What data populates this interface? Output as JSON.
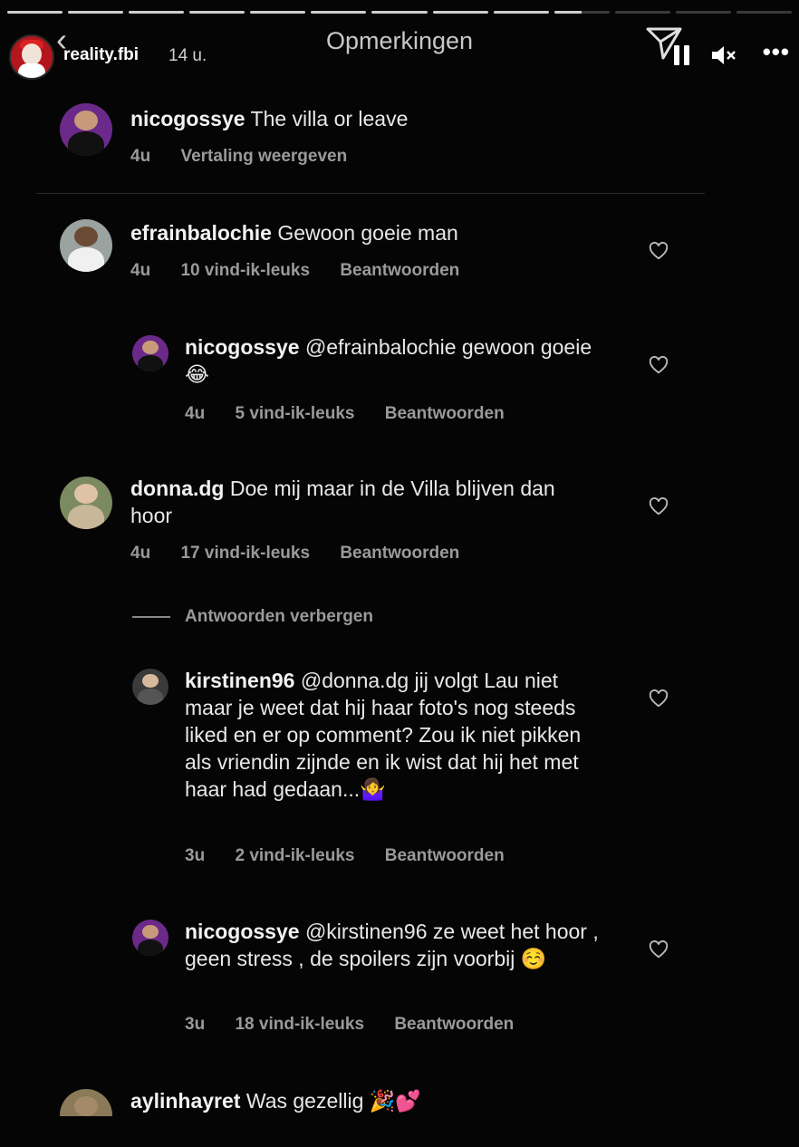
{
  "story": {
    "username": "reality.fbi",
    "time": "14 u.",
    "progress_segments": [
      1,
      1,
      1,
      1,
      1,
      1,
      1,
      1,
      1,
      0.5,
      0,
      0,
      0
    ]
  },
  "sheet": {
    "title": "Opmerkingen"
  },
  "caption": {
    "username": "nicogossye",
    "text": "The villa or leave",
    "time": "4u",
    "translate_label": "Vertaling weergeven"
  },
  "comments": [
    {
      "username": "efrainbalochie",
      "text": "Gewoon goeie man",
      "time": "4u",
      "likes": "10 vind-ik-leuks",
      "reply_label": "Beantwoorden"
    },
    {
      "username": "nicogossye",
      "text": "@efrainbalochie gewoon goeie 😂",
      "time": "4u",
      "likes": "5 vind-ik-leuks",
      "reply_label": "Beantwoorden"
    },
    {
      "username": "donna.dg",
      "text": "Doe mij maar in de Villa blijven dan hoor",
      "time": "4u",
      "likes": "17 vind-ik-leuks",
      "reply_label": "Beantwoorden"
    },
    {
      "username": "kirstinen96",
      "text": "@donna.dg jij volgt Lau niet maar je weet dat hij haar foto's nog steeds liked en er op comment? Zou ik niet pikken als vriendin zijnde en ik wist dat hij het met haar had gedaan...🤷‍♀️",
      "time": "3u",
      "likes": "2 vind-ik-leuks",
      "reply_label": "Beantwoorden"
    },
    {
      "username": "nicogossye",
      "text": "@kirstinen96 ze weet het hoor , geen stress , de spoilers zijn voorbij ☺️",
      "time": "3u",
      "likes": "18 vind-ik-leuks",
      "reply_label": "Beantwoorden"
    },
    {
      "username": "aylinhayret",
      "text": "Was gezellig 🎉💕"
    }
  ],
  "hide_replies_label": "Antwoorden verbergen",
  "icons": [
    "back-icon",
    "send-icon",
    "pause-icon",
    "mute-icon",
    "more-icon",
    "heart-icon"
  ]
}
